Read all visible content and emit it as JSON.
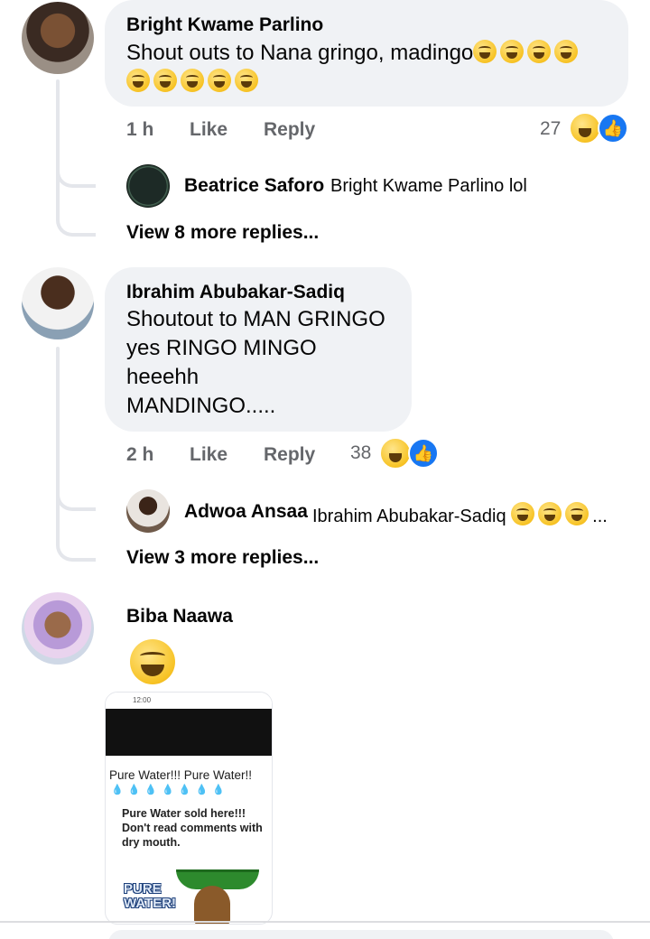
{
  "comments": [
    {
      "author": "Bright Kwame Parlino",
      "text_line1": "Shout outs to Nana gringo, madingo",
      "time": "1 h",
      "like_label": "Like",
      "reply_label": "Reply",
      "reaction_count": "27",
      "reply_preview": {
        "author": "Beatrice Saforo",
        "text": "Bright Kwame Parlino lol"
      },
      "more_replies": "View 8 more replies..."
    },
    {
      "author": "Ibrahim Abubakar-Sadiq",
      "text_lines": [
        "Shoutout to MAN GRINGO",
        "yes RINGO MINGO",
        "heeehh",
        "MANDINGO....."
      ],
      "time": "2 h",
      "like_label": "Like",
      "reply_label": "Reply",
      "reaction_count": "38",
      "reply_preview": {
        "author": "Adwoa Ansaa",
        "text": "Ibrahim Abubakar-Sadiq",
        "ellipsis": "..."
      },
      "more_replies": "View 3 more replies..."
    },
    {
      "author": "Biba Naawa",
      "attachment": {
        "status_time": "12:00",
        "title": "Pure Water!!! Pure Water!!",
        "drops": "💧💧💧💧💧💧💧",
        "body": "Pure Water sold here!!! Don't read comments with dry mouth.",
        "logo_line1": "PURE",
        "logo_line2": "WATER!"
      }
    }
  ],
  "colors": {
    "bubble": "#f0f2f5",
    "meta_text": "#65676b",
    "like_blue": "#1877f2",
    "thread_line": "#e4e6eb"
  },
  "icons": [
    "haha-reaction-icon",
    "like-reaction-icon",
    "laughing-emoji-icon",
    "grinning-emoji-icon"
  ]
}
